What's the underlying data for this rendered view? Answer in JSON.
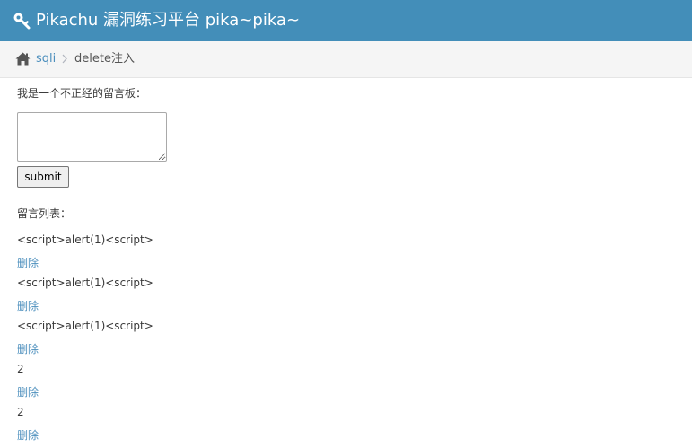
{
  "header": {
    "title": "Pikachu 漏洞练习平台 pika~pika~",
    "icon": "key-icon"
  },
  "breadcrumb": {
    "home_icon": "home-icon",
    "parent": "sqli",
    "current": "delete注入"
  },
  "form": {
    "label": "我是一个不正经的留言板：",
    "textarea_value": "",
    "submit_label": "submit"
  },
  "messages": {
    "label": "留言列表：",
    "items": [
      {
        "text": "<script>alert(1)<script>",
        "delete_label": "删除"
      },
      {
        "text": "<script>alert(1)<script>",
        "delete_label": "删除"
      },
      {
        "text": "<script>alert(1)<script>",
        "delete_label": "删除"
      },
      {
        "text": "2",
        "delete_label": "删除"
      },
      {
        "text": "2",
        "delete_label": "删除"
      }
    ]
  },
  "colors": {
    "navbar": "#438eb9",
    "link": "#4c8fbd",
    "breadcrumb_bg": "#f5f5f5"
  }
}
